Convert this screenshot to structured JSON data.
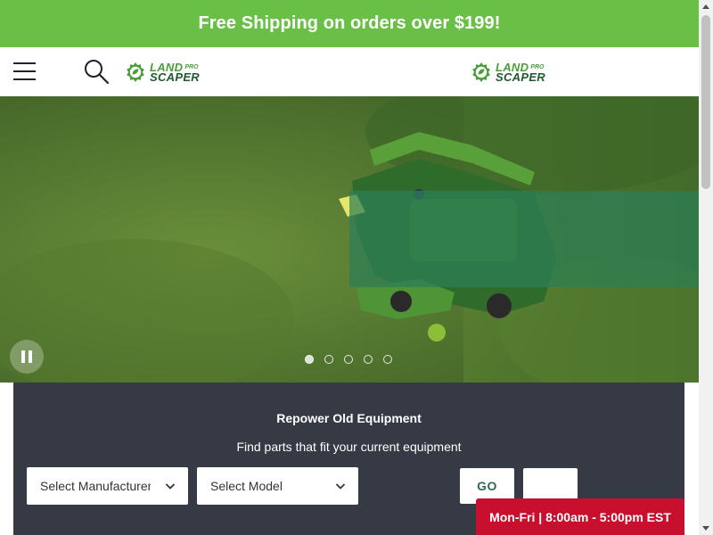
{
  "promo": {
    "text": "Free Shipping on orders over $199!"
  },
  "header": {
    "logo": {
      "line1": "LAND",
      "pro": "PRO",
      "line2": "SCAPER"
    },
    "icons": {
      "menu": "hamburger-icon",
      "search": "search-icon",
      "logo_mark": "leaf-badge-icon"
    }
  },
  "hero": {
    "slide_count": 5,
    "active_slide": 1,
    "icons": {
      "pause": "pause-icon"
    }
  },
  "repower": {
    "title": "Repower Old Equipment",
    "subtitle": "Find parts that fit your current equipment",
    "manufacturer_select": {
      "value": "Select Manufacturer"
    },
    "model_select": {
      "value": "Select Model"
    },
    "go_label": "GO",
    "icons": {
      "dropdown": "chevron-down-icon"
    }
  },
  "hours": {
    "text": "Mon-Fri | 8:00am - 5:00pm EST"
  },
  "colors": {
    "promo_green": "#6abf47",
    "logo_light_green": "#4b9d3a",
    "logo_dark_green": "#1e5b2c",
    "panel_dark": "#363a45",
    "hours_red": "#c8102e",
    "overlay_green": "#2c7e56"
  }
}
